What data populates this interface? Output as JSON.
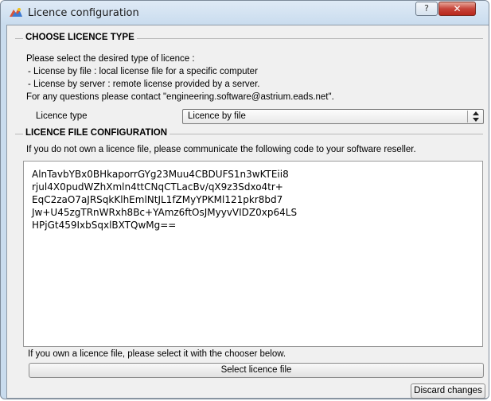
{
  "window": {
    "title": "Licence configuration",
    "help_label": "?",
    "close_label": "✕"
  },
  "licence_type_group": {
    "title": "CHOOSE LICENCE TYPE",
    "intro": "Please select the desired type of licence :",
    "option_file": "- License by file : local license file for a specific computer",
    "option_server": "- License by server : remote license provided by a server.",
    "contact": "For any questions please contact \"engineering.software@astrium.eads.net\".",
    "type_label": "Licence type",
    "type_value": "Licence by file"
  },
  "licence_file_group": {
    "title": "LICENCE FILE CONFIGURATION",
    "instructions": "If you do not own a licence file, please communicate the following code to your software reseller.",
    "code_lines": [
      "AlnTavbYBx0BHkaporrGYg23Muu4CBDUFS1n3wKTEii8",
      "rjul4X0pudWZhXmln4ttCNqCTLacBv/qX9z3Sdxo4tr+",
      "EqC2zaO7aJRSqkKlhEmlNtJL1fZMyYPKMl121pkr8bd7",
      "Jw+U45zgTRnWRxh8Bc+YAmz6ftOsJMyyvVIDZ0xp64LS",
      "HPjGt459IxbSqxlBXTQwMg=="
    ],
    "own_file_text": "If you own a licence file, please select it with the chooser below.",
    "select_button": "Select licence file"
  },
  "footer": {
    "discard_button": "Discard changes"
  },
  "colors": {
    "title_bar": "#c9dcee",
    "close_button": "#c7443a",
    "client_background": "#f0f0f0"
  }
}
